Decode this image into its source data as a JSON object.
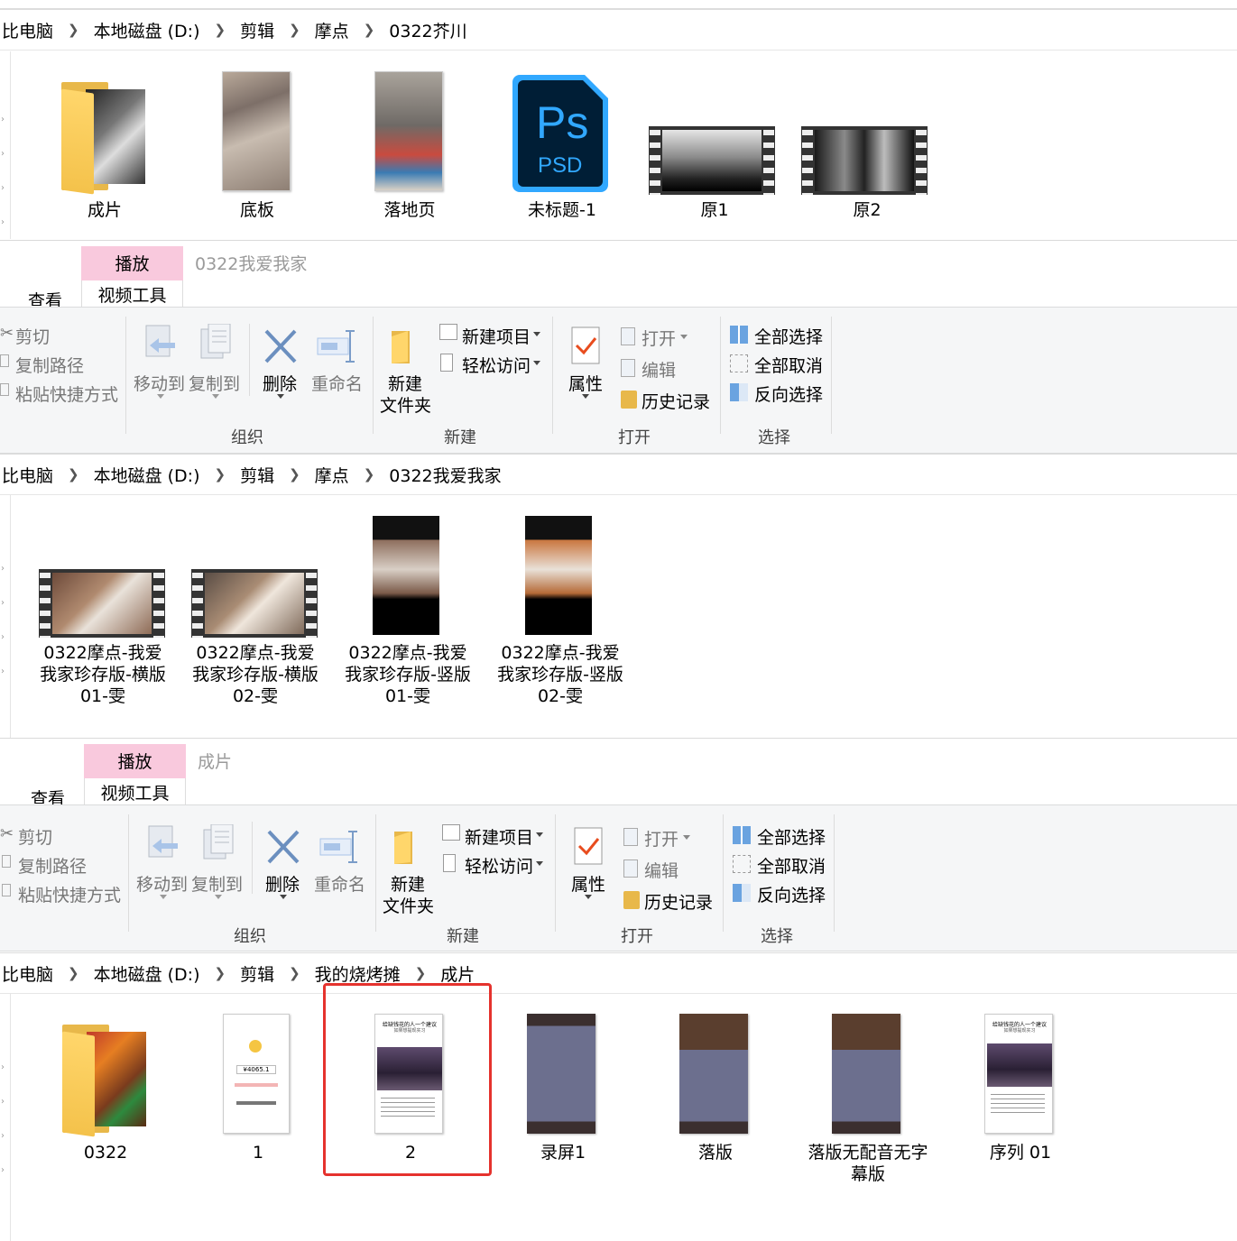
{
  "section1": {
    "breadcrumb": [
      "比电脑",
      "本地磁盘 (D:)",
      "剪辑",
      "摩点",
      "0322芥川"
    ],
    "items": [
      "成片",
      "底板",
      "落地页",
      "未标题-1",
      "原1",
      "原2"
    ],
    "psd_icon": {
      "ps": "Ps",
      "psd": "PSD"
    }
  },
  "ribbon1": {
    "tabs": {
      "play": "播放",
      "tools": "视频工具",
      "view": "查看"
    },
    "window_title": "0322我爱我家",
    "clipboard": [
      "剪切",
      "复制路径",
      "粘贴快捷方式"
    ],
    "organize": [
      "移动到",
      "复制到",
      "删除",
      "重命名"
    ],
    "new_folder": [
      "新建",
      "文件夹"
    ],
    "new_item": "新建项目",
    "easy_access": "轻松访问",
    "properties": "属性",
    "open": "打开",
    "edit": "编辑",
    "history": "历史记录",
    "select_all": "全部选择",
    "select_none": "全部取消",
    "invert": "反向选择",
    "groups": [
      "组织",
      "新建",
      "打开",
      "选择"
    ]
  },
  "section2": {
    "breadcrumb": [
      "比电脑",
      "本地磁盘 (D:)",
      "剪辑",
      "摩点",
      "0322我爱我家"
    ],
    "items": [
      [
        "0322摩点-我爱",
        "我家珍存版-横版",
        "01-雯"
      ],
      [
        "0322摩点-我爱",
        "我家珍存版-横版",
        "02-雯"
      ],
      [
        "0322摩点-我爱",
        "我家珍存版-竖版",
        "01-雯"
      ],
      [
        "0322摩点-我爱",
        "我家珍存版-竖版",
        "02-雯"
      ]
    ]
  },
  "ribbon2": {
    "tabs": {
      "play": "播放",
      "tools": "视频工具",
      "view": "查看"
    },
    "window_title": "成片",
    "clipboard": [
      "剪切",
      "复制路径",
      "粘贴快捷方式"
    ],
    "organize": [
      "移动到",
      "复制到",
      "删除",
      "重命名"
    ],
    "new_folder": [
      "新建",
      "文件夹"
    ],
    "new_item": "新建项目",
    "easy_access": "轻松访问",
    "properties": "属性",
    "open": "打开",
    "edit": "编辑",
    "history": "历史记录",
    "select_all": "全部选择",
    "select_none": "全部取消",
    "invert": "反向选择",
    "groups": [
      "组织",
      "新建",
      "打开",
      "选择"
    ]
  },
  "section3": {
    "breadcrumb": [
      "比电脑",
      "本地磁盘 (D:)",
      "剪辑",
      "我的烧烤摊",
      "成片"
    ],
    "items": [
      [
        "0322"
      ],
      [
        "1"
      ],
      [
        "2"
      ],
      [
        "录屏1"
      ],
      [
        "落版"
      ],
      [
        "落版无配音无字",
        "幕版"
      ],
      [
        "序列 01"
      ]
    ],
    "doc_title": "给缺钱花的人一个建议",
    "doc_sub": "如果想提现实习",
    "phone_amount": "¥4065.1"
  },
  "colors": {
    "play_tab": "#f9c9dd",
    "highlight": "#e5322d",
    "ps_blue": "#31a8ff",
    "ps_bg": "#001e36"
  }
}
